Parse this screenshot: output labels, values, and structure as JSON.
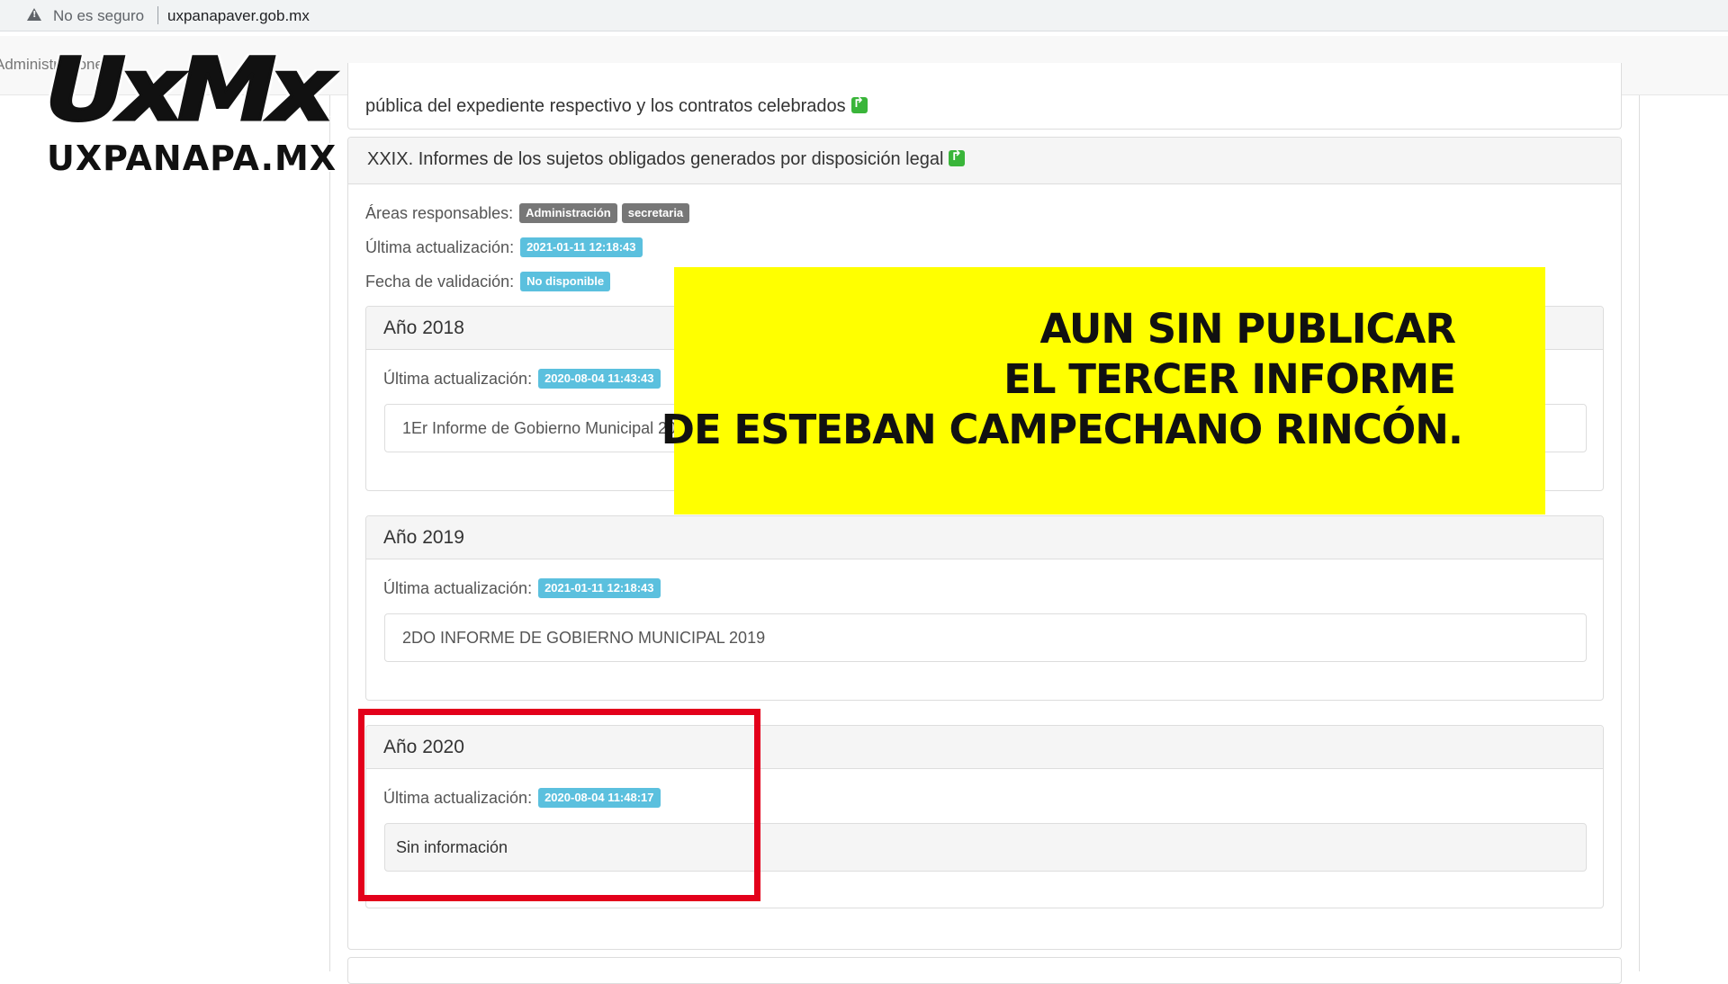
{
  "browser": {
    "security_label": "No es seguro",
    "url": "uxpanapaver.gob.mx"
  },
  "site_nav": {
    "item_label": "Administraciones"
  },
  "logo": {
    "main": "UxMx",
    "sub": "UXPANAPA.MX"
  },
  "prev_section": {
    "text": "pública del expediente respectivo y los contratos celebrados"
  },
  "section": {
    "title": "XXIX. Informes de los sujetos obligados generados por disposición legal",
    "areas_label": "Áreas responsables:",
    "areas": [
      "Administración",
      "secretaria"
    ],
    "updated_label": "Última actualización:",
    "updated_value": "2021-01-11 12:18:43",
    "validation_label": "Fecha de validación:",
    "validation_value": "No disponible"
  },
  "years": [
    {
      "title": "Año 2018",
      "updated_label": "Última actualización:",
      "updated_value": "2020-08-04 11:43:43",
      "document": "1Er Informe de Gobierno Municipal 2018"
    },
    {
      "title": "Año 2019",
      "updated_label": "Última actualización:",
      "updated_value": "2021-01-11 12:18:43",
      "document": "2DO INFORME DE GOBIERNO MUNICIPAL 2019"
    },
    {
      "title": "Año 2020",
      "updated_label": "Última actualización:",
      "updated_value": "2020-08-04 11:48:17",
      "document": "Sin información"
    }
  ],
  "overlay": {
    "line1": "AUN SIN PUBLICAR",
    "line2": "EL TERCER INFORME",
    "line3": "DE ESTEBAN CAMPECHANO RINCÓN."
  },
  "colors": {
    "highlight_yellow": "#ffff00",
    "frame_red": "#e3001b",
    "badge_info": "#5bc0de",
    "badge_gray": "#777777"
  }
}
